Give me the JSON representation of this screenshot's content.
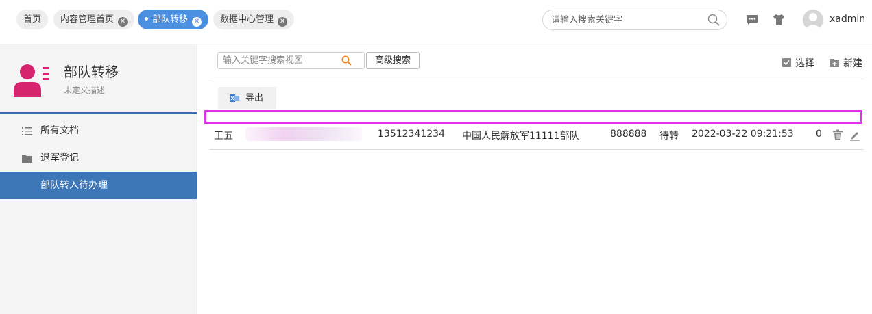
{
  "tabs": [
    {
      "label": "首页",
      "closable": false,
      "active": false
    },
    {
      "label": "内容管理首页",
      "closable": true,
      "active": false
    },
    {
      "label": "部队转移",
      "closable": true,
      "active": true
    },
    {
      "label": "数据中心管理",
      "closable": true,
      "active": false
    }
  ],
  "header": {
    "search_placeholder": "请输入搜索关键字",
    "username": "xadmin"
  },
  "sidebar": {
    "title": "部队转移",
    "description": "未定义描述",
    "items": [
      {
        "label": "所有文档",
        "icon": "list-icon"
      },
      {
        "label": "退军登记",
        "icon": "folder-icon"
      },
      {
        "label": "部队转入待办理",
        "icon": "",
        "active": true
      }
    ]
  },
  "toolbar": {
    "keyword_placeholder": "输入关键字搜索视图",
    "advanced_search": "高级搜索",
    "select_label": "选择",
    "new_label": "新建",
    "export_label": "导出"
  },
  "table": {
    "rows": [
      {
        "name": "王五",
        "id_number": "",
        "phone": "13512341234",
        "unit": "中国人民解放军11111部队",
        "code": "888888",
        "status": "待转",
        "time": "2022-03-22 09:21:53",
        "count": "0"
      }
    ]
  },
  "colors": {
    "accent": "#4a8fe0",
    "sidebar_active": "#3d77b8",
    "highlight_border": "#e033e8",
    "user_icon": "#d6246e"
  }
}
